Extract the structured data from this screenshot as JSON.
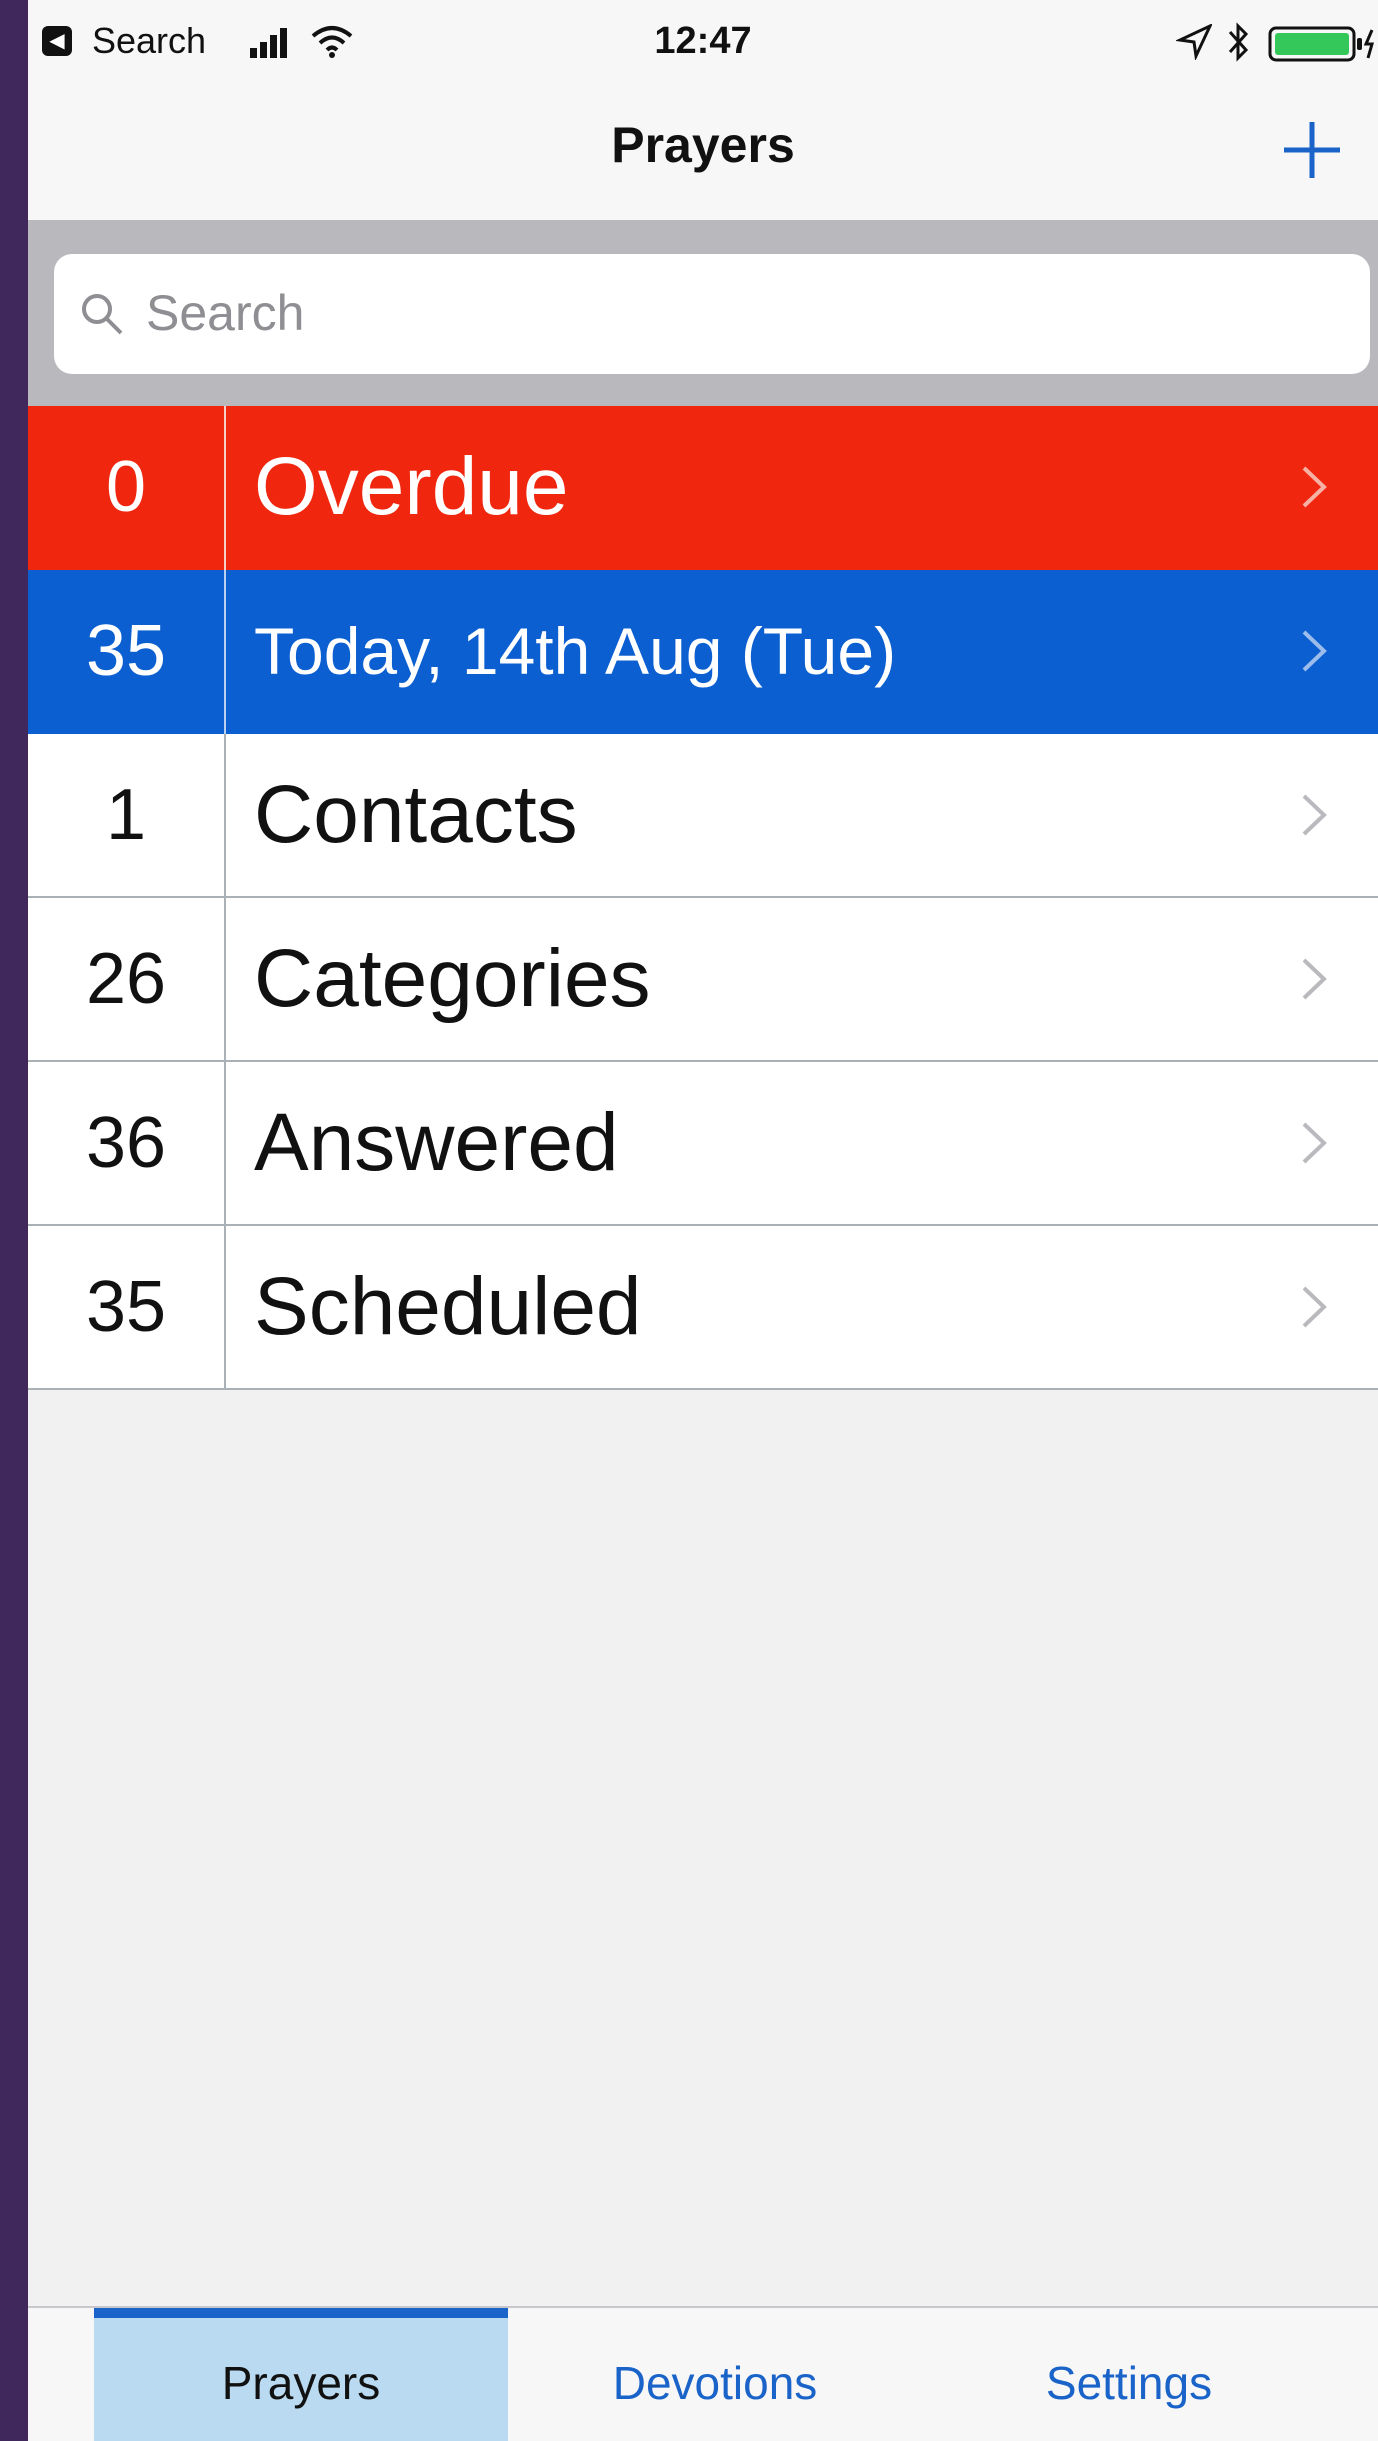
{
  "status_bar": {
    "app_label": "Search",
    "back_glyph": "◀",
    "time": "12:47",
    "icons": [
      "signal-icon",
      "wifi-icon",
      "location-icon",
      "bluetooth-icon",
      "battery-icon"
    ],
    "battery_color": "#34c759"
  },
  "nav": {
    "title": "Prayers",
    "add_icon": "plus-icon",
    "accent_color": "#1a63c9"
  },
  "search": {
    "placeholder": "Search",
    "icon": "search-icon"
  },
  "list": {
    "rows": [
      {
        "count": "0",
        "label": "Overdue",
        "color": "#f0260e"
      },
      {
        "count": "35",
        "label": "Today, 14th Aug (Tue)",
        "color": "#0b5fd1"
      },
      {
        "count": "1",
        "label": "Contacts"
      },
      {
        "count": "26",
        "label": "Categories"
      },
      {
        "count": "36",
        "label": "Answered"
      },
      {
        "count": "35",
        "label": "Scheduled"
      }
    ],
    "chevron_icon": "chevron-right-icon"
  },
  "tabs": {
    "items": [
      {
        "label": "Prayers",
        "active": true
      },
      {
        "label": "Devotions",
        "active": false
      },
      {
        "label": "Settings",
        "active": false
      }
    ]
  }
}
